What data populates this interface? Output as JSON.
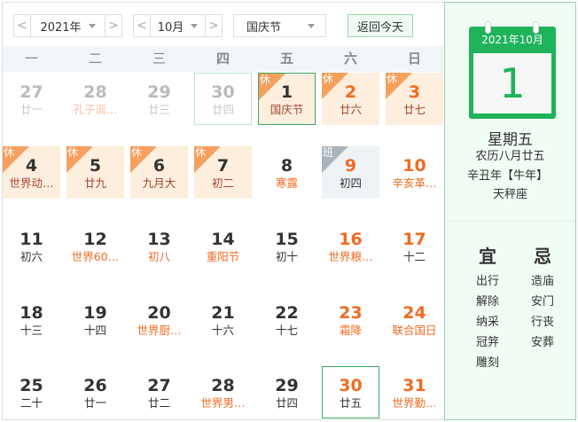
{
  "toolbar": {
    "year": "2021年",
    "month": "10月",
    "holiday": "国庆节",
    "today_button": "返回今天",
    "prev": "<",
    "next": ">"
  },
  "weekdays": [
    "一",
    "二",
    "三",
    "四",
    "五",
    "六",
    "日"
  ],
  "weeks": [
    [
      {
        "d": "27",
        "l": "廿一",
        "other": true
      },
      {
        "d": "28",
        "l": "孔子诞…",
        "other": true,
        "fest": true
      },
      {
        "d": "29",
        "l": "廿三",
        "other": true
      },
      {
        "d": "30",
        "l": "廿四",
        "other": true,
        "today": true
      },
      {
        "d": "1",
        "l": "国庆节",
        "rest": true,
        "sel": true
      },
      {
        "d": "2",
        "l": "廿六",
        "rest": true,
        "we": true
      },
      {
        "d": "3",
        "l": "廿七",
        "rest": true,
        "we": true
      }
    ],
    [
      {
        "d": "4",
        "l": "世界动…",
        "rest": true
      },
      {
        "d": "5",
        "l": "廿九",
        "rest": true
      },
      {
        "d": "6",
        "l": "九月大",
        "rest": true
      },
      {
        "d": "7",
        "l": "初二",
        "rest": true
      },
      {
        "d": "8",
        "l": "寒露",
        "fest": true
      },
      {
        "d": "9",
        "l": "初四",
        "work": true,
        "we": true
      },
      {
        "d": "10",
        "l": "辛亥革…",
        "fest": true,
        "we": true
      }
    ],
    [
      {
        "d": "11",
        "l": "初六"
      },
      {
        "d": "12",
        "l": "世界60…",
        "fest": true
      },
      {
        "d": "13",
        "l": "初八",
        "fest": true
      },
      {
        "d": "14",
        "l": "重阳节",
        "fest": true
      },
      {
        "d": "15",
        "l": "初十"
      },
      {
        "d": "16",
        "l": "世界粮…",
        "fest": true,
        "we": true
      },
      {
        "d": "17",
        "l": "十二",
        "we": true
      }
    ],
    [
      {
        "d": "18",
        "l": "十三"
      },
      {
        "d": "19",
        "l": "十四"
      },
      {
        "d": "20",
        "l": "世界厨…",
        "fest": true
      },
      {
        "d": "21",
        "l": "十六"
      },
      {
        "d": "22",
        "l": "十七"
      },
      {
        "d": "23",
        "l": "霜降",
        "fest": true,
        "we": true
      },
      {
        "d": "24",
        "l": "联合国日",
        "fest": true,
        "we": true
      }
    ],
    [
      {
        "d": "25",
        "l": "二十"
      },
      {
        "d": "26",
        "l": "廿一"
      },
      {
        "d": "27",
        "l": "廿二"
      },
      {
        "d": "28",
        "l": "世界男…",
        "fest": true
      },
      {
        "d": "29",
        "l": "廿四"
      },
      {
        "d": "30",
        "l": "廿五",
        "we": true,
        "hl": true
      },
      {
        "d": "31",
        "l": "世界勤…",
        "fest": true,
        "we": true
      }
    ]
  ],
  "tags": {
    "rest": "休",
    "work": "班"
  },
  "side": {
    "header": "2021年10月",
    "day": "1",
    "weekday": "星期五",
    "lunar": "农历八月廿五",
    "ganzhi": "辛丑年【牛年】",
    "zodiac": "天秤座",
    "yi_title": "宜",
    "ji_title": "忌",
    "yi": [
      "出行",
      "解除",
      "纳采",
      "冠笄",
      "雕刻"
    ],
    "ji": [
      "造庙",
      "安门",
      "行丧",
      "安葬"
    ]
  },
  "colors": {
    "accent": "#1fb35b",
    "orange": "#f26a21",
    "rest_bg": "#fdeede"
  }
}
